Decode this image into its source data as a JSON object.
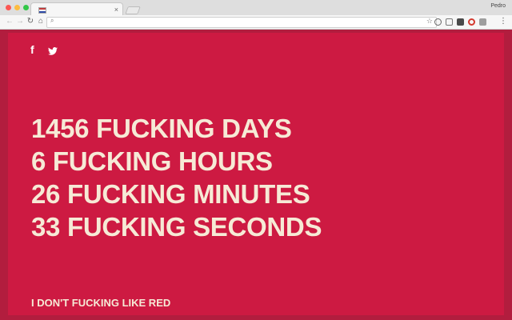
{
  "browser": {
    "tab": {
      "title": "",
      "favicon": "us-flag-icon",
      "close_glyph": "×"
    },
    "profile_name": "Pedro",
    "nav": {
      "back_glyph": "←",
      "forward_glyph": "→",
      "reload_glyph": "↻",
      "home_glyph": "⌂"
    },
    "omnibox": {
      "url": "",
      "search_glyph": "⌕",
      "star_glyph": "☆"
    },
    "menu_glyph": "⋮"
  },
  "page": {
    "colors": {
      "background": "#cd1a42",
      "frame": "#b21d3e",
      "text": "#f6ead6"
    },
    "social": {
      "facebook_glyph": "f",
      "twitter_icon": "twitter-bird-icon"
    },
    "counter_lines": [
      "1456 FUCKING DAYS",
      "6 FUCKING HOURS",
      "26 FUCKING MINUTES",
      "33 FUCKING SECONDS"
    ],
    "footer_link": "I DON'T FUCKING LIKE RED"
  }
}
